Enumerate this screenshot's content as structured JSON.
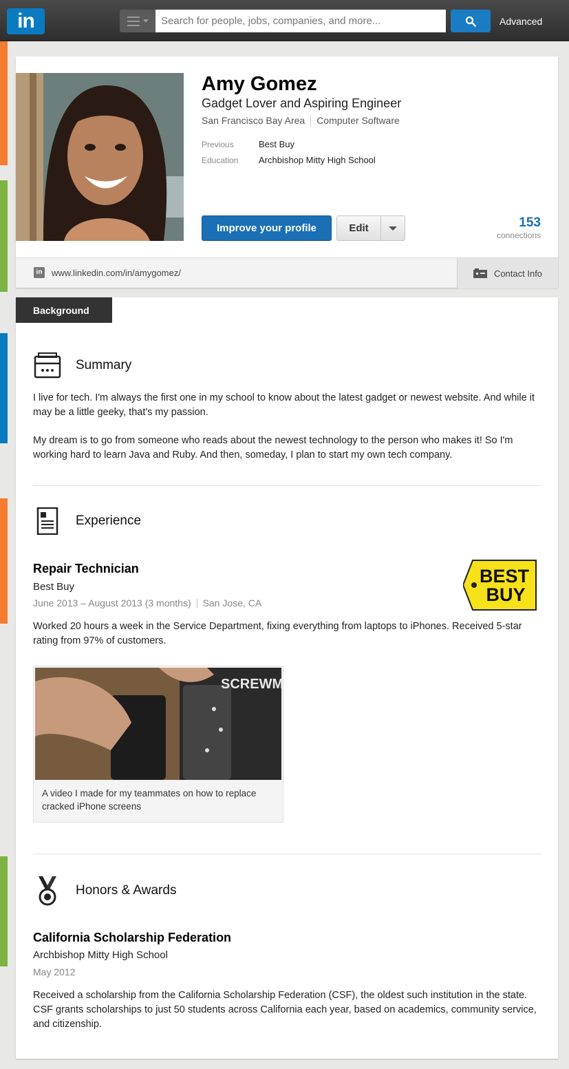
{
  "colors": {
    "brand": "#0a7bc1",
    "primary_button": "#1a6fb5",
    "side_tabs": [
      "#f47c2e",
      "#7cb342",
      "#0a7bc1",
      "#f47c2e",
      "#7cb342"
    ]
  },
  "header": {
    "logo_text": "in",
    "search_placeholder": "Search for people, jobs, companies, and more...",
    "advanced_label": "Advanced"
  },
  "profile": {
    "name": "Amy Gomez",
    "headline": "Gadget Lover and Aspiring Engineer",
    "location": "San Francisco Bay Area",
    "industry": "Computer Software",
    "previous_label": "Previous",
    "previous_value": "Best Buy",
    "education_label": "Education",
    "education_value": "Archbishop Mitty High School",
    "improve_button": "Improve your profile",
    "edit_button": "Edit",
    "connections_count": "153",
    "connections_label": "connections",
    "public_url": "www.linkedin.com/in/amygomez/",
    "contact_info_label": "Contact Info"
  },
  "background": {
    "tab_label": "Background",
    "summary": {
      "title": "Summary",
      "p1": "I live for tech. I'm always the first one in my school to know about the latest gadget or newest website. And while it may be a little geeky, that's my passion.",
      "p2": "My dream is to go from someone who reads about the newest technology to the person who makes it! So I'm working hard to learn Java and Ruby. And then, someday, I plan to start my own tech company."
    },
    "experience": {
      "title": "Experience",
      "job_title": "Repair Technician",
      "company": "Best Buy",
      "dates": "June 2013 – August 2013 (3 months)",
      "location": "San Jose, CA",
      "description": "Worked 20 hours a week in the Service Department, fixing everything from laptops to iPhones. Received 5-star rating from 97% of customers.",
      "media_caption": "A video I made for my teammates on how to replace cracked iPhone screens",
      "company_logo_text": [
        "BEST",
        "BUY"
      ],
      "media_mat_text": "SCREWMAT"
    },
    "honors": {
      "title": "Honors & Awards",
      "award": "California Scholarship Federation",
      "issuer": "Archbishop Mitty High School",
      "date": "May 2012",
      "description": "Received a scholarship from the California Scholarship Federation (CSF), the oldest such institution in the state. CSF grants scholarships to just 50 students across California each year, based on academics, community service, and citizenship."
    }
  }
}
